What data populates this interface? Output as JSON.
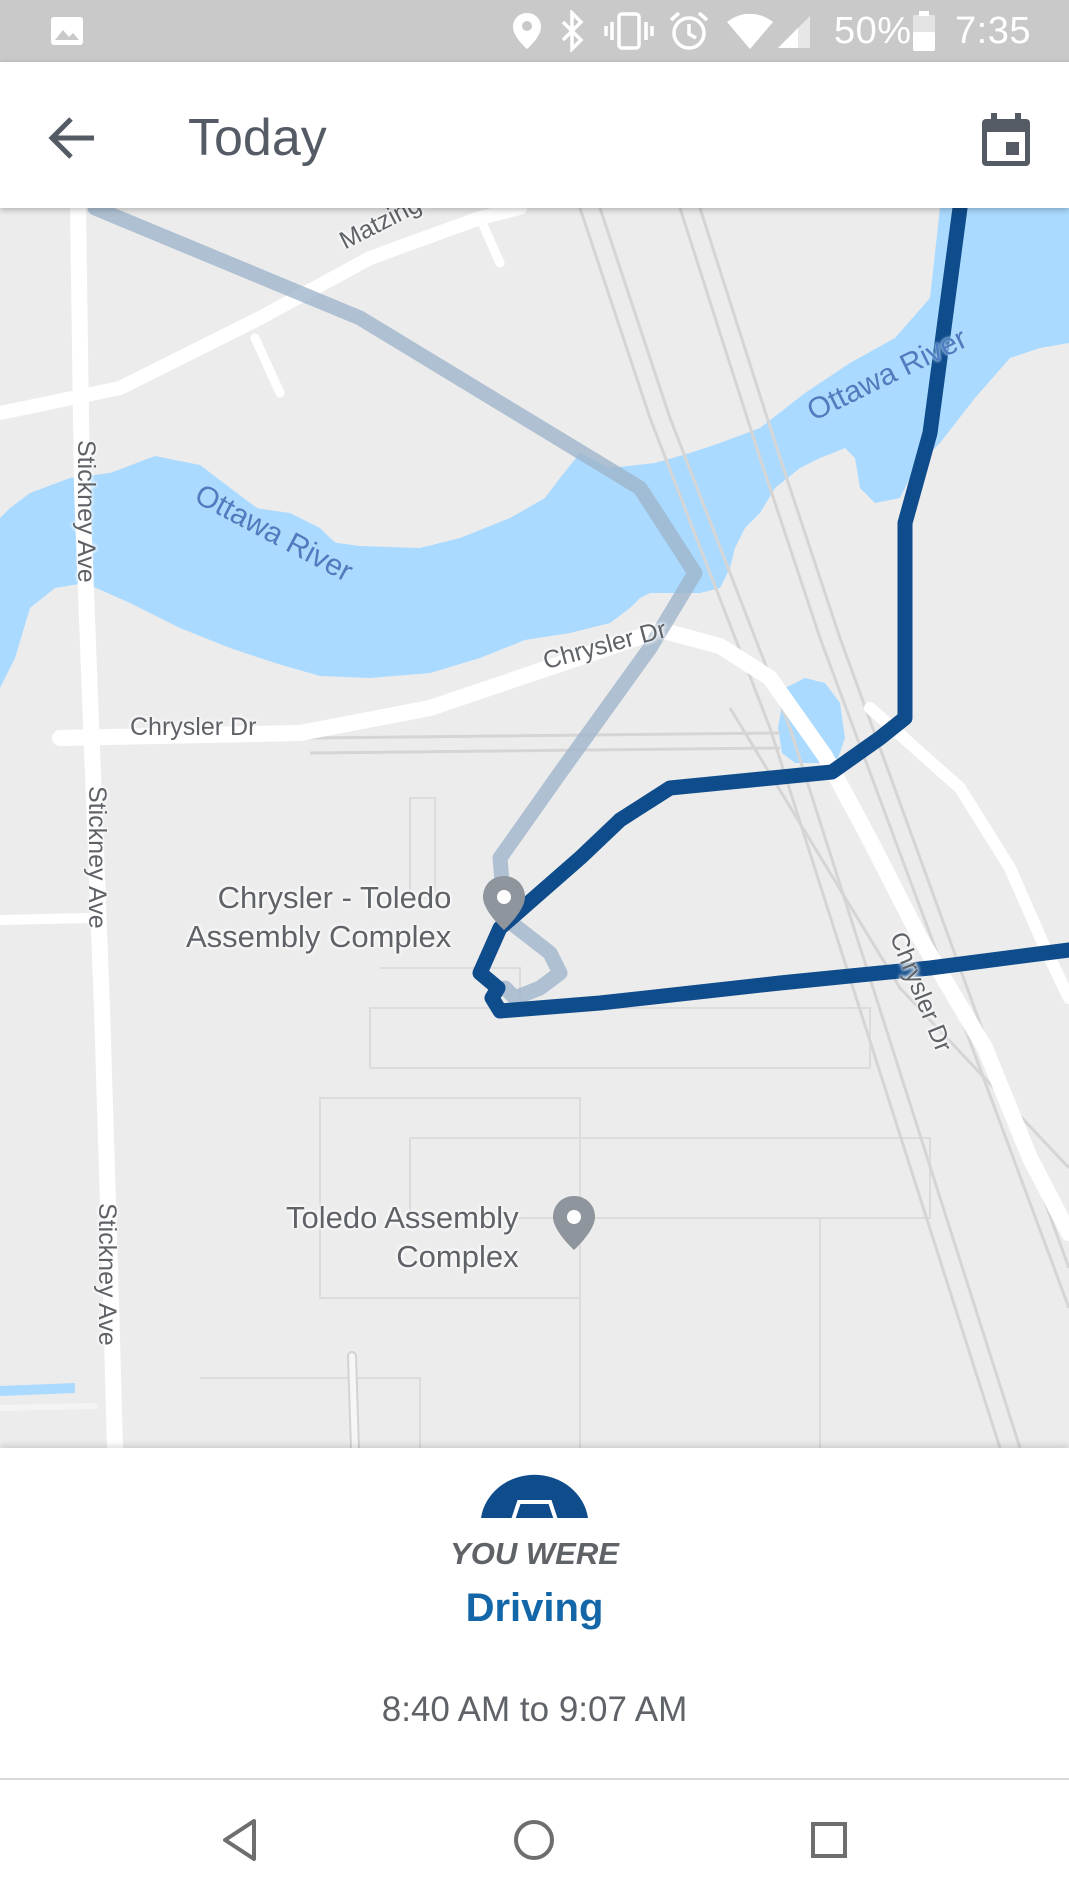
{
  "status_bar": {
    "battery": "50%",
    "time": "7:35",
    "icons": [
      "image-icon",
      "location-icon",
      "bluetooth-icon",
      "vibrate-icon",
      "alarm-icon",
      "wifi-icon",
      "cellular-signal-icon",
      "battery-icon"
    ]
  },
  "app_bar": {
    "title": "Today",
    "back_icon": "arrow-back-icon",
    "calendar_icon": "calendar-icon"
  },
  "map": {
    "street_labels": {
      "matzinger": "Matzinger Rd",
      "stickney_1": "Stickney Ave",
      "stickney_2": "Stickney Ave",
      "stickney_3": "Stickney Ave",
      "chrysler_1": "Chrysler Dr",
      "chrysler_2": "Chrysler Dr",
      "chrysler_3": "Chrysler Dr"
    },
    "river_labels": {
      "ottawa_1": "Ottawa River",
      "ottawa_2": "Ottawa River"
    },
    "places": {
      "poi_1": {
        "line1": "Chrysler - Toledo",
        "line2": "Assembly Complex"
      },
      "poi_2": {
        "line1": "Toledo Assembly",
        "line2": "Complex"
      }
    },
    "colors": {
      "land": "#ececec",
      "water": "#aadaff",
      "road": "#ffffff",
      "route_active": "#0f4c8c",
      "route_faded": "#9fb5cc",
      "pin": "#8f959d"
    }
  },
  "activity": {
    "icon": "car-icon",
    "you_were_label": "YOU WERE",
    "type": "Driving",
    "time_range": "8:40 AM to 9:07 AM",
    "accent_color": "#1366a8"
  },
  "nav_bar": {
    "back_icon": "nav-back-icon",
    "home_icon": "nav-home-icon",
    "recents_icon": "nav-recents-icon"
  }
}
